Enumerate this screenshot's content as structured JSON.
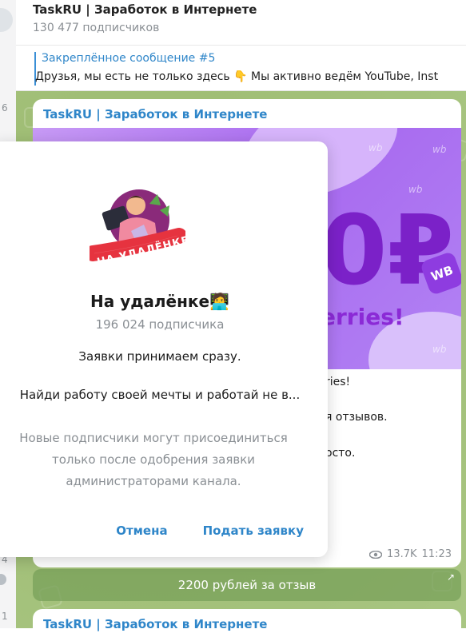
{
  "header": {
    "title": "TaskRU | Заработок в Интернете",
    "subscribers": "130 477 подписчиков"
  },
  "pinned": {
    "title": "Закреплённое сообщение #5",
    "text": "Друзья, мы есть не только здесь 👇 Мы активно ведём YouTube, Inst"
  },
  "left_strip": {
    "numbers": [
      "6",
      "4",
      "1"
    ]
  },
  "post": {
    "channel": "TaskRU | Заработок в Интернете",
    "banner_big": "0₽",
    "banner_badge": "WB",
    "banner_text": "erries!",
    "text_lines": [
      "ries!",
      "я отзывов.",
      "осто."
    ],
    "views": "13.7K",
    "time": "11:23"
  },
  "inline_button": {
    "label": "2200 рублей за отзыв",
    "arrow": "↗"
  },
  "next_post": {
    "channel": "TaskRU | Заработок в Интернете"
  },
  "modal": {
    "logo_text": "НА УДАЛЁНКЕ",
    "name": "На удалёнке🧑‍💻",
    "subscribers": "196 024 подписчика",
    "description_line1": "Заявки принимаем сразу.",
    "description_line2": "Найди работу своей мечты и работай не в...",
    "note": "Новые подписчики могут присоединиться только после одобрения заявки администраторами канала.",
    "cancel_label": "Отмена",
    "submit_label": "Подать заявку"
  },
  "colors": {
    "accent": "#2f86c9",
    "chat_bg": "#a9c683",
    "banner_purple": "#a768ef"
  }
}
